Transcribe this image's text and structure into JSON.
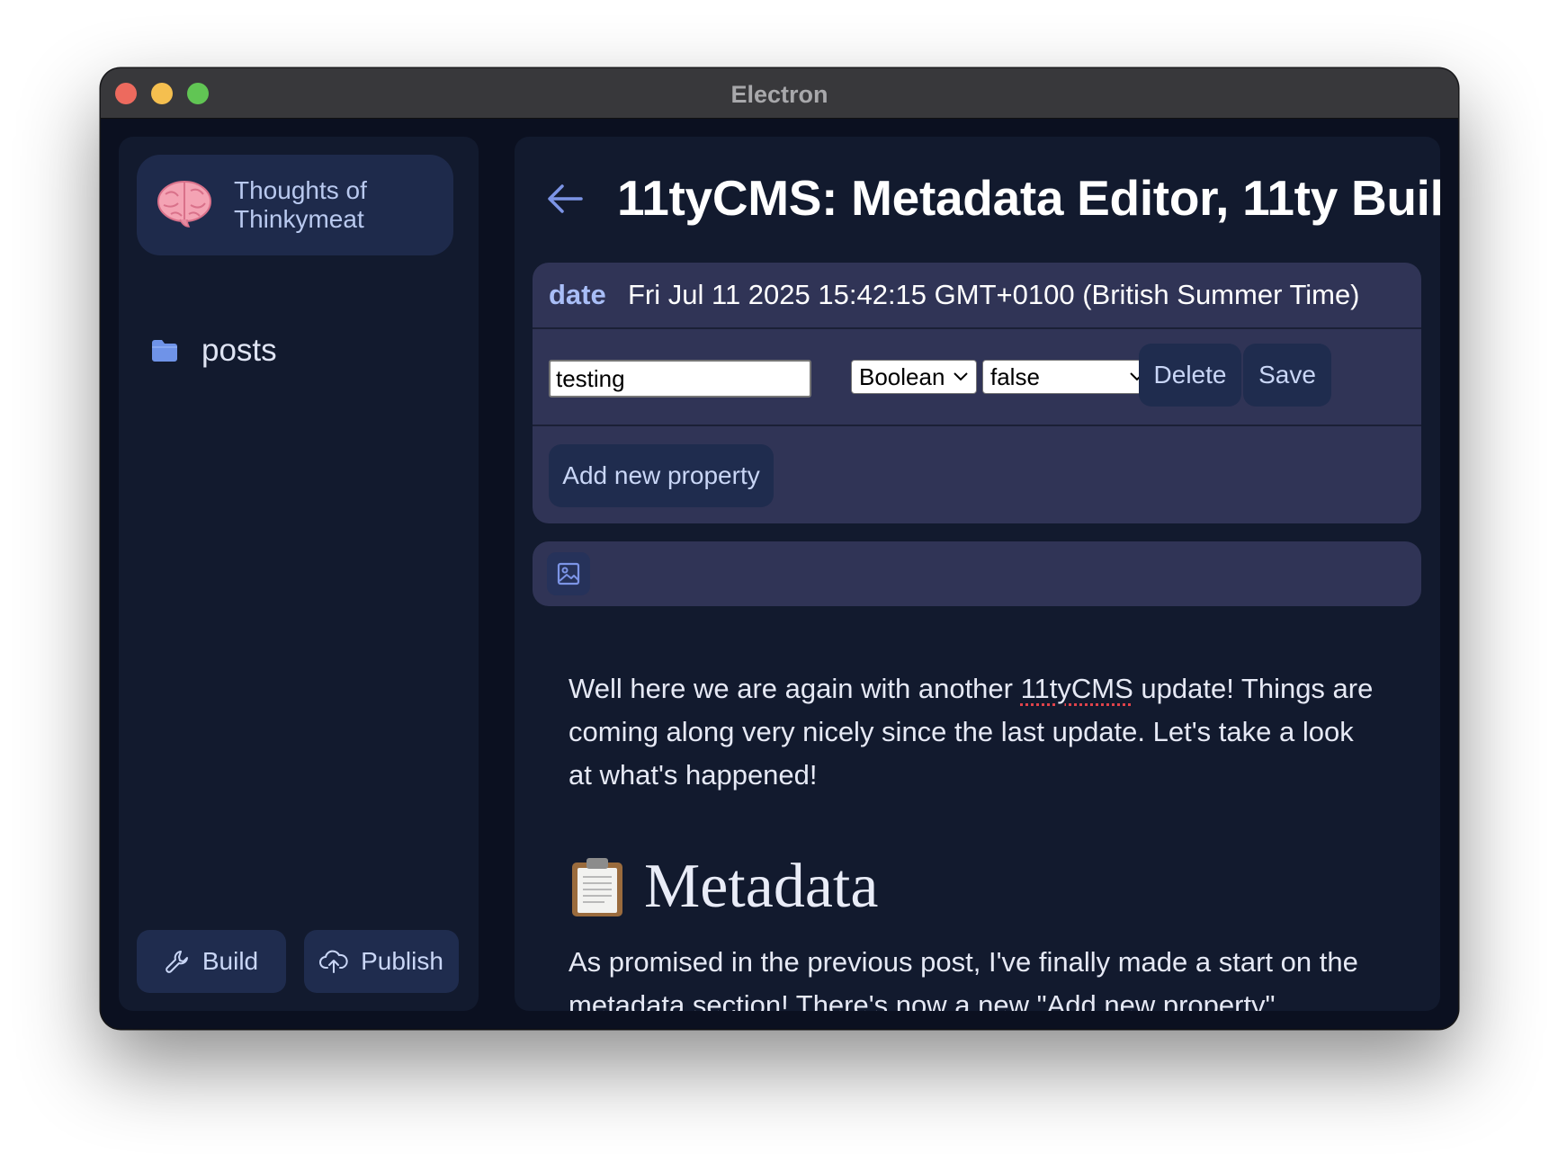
{
  "window": {
    "title": "Electron"
  },
  "sidebar": {
    "site_title": "Thoughts of Thinkymeat",
    "nav_items": [
      {
        "label": "posts"
      }
    ],
    "build_label": "Build",
    "publish_label": "Publish"
  },
  "main": {
    "page_title": "11tyCMS: Metadata Editor, 11ty Buil",
    "metadata": {
      "date_key": "date",
      "date_value": "Fri Jul 11 2025 15:42:15 GMT+0100 (British Summer Time)",
      "property_name_value": "testing",
      "type_select_value": "Boolean",
      "value_select_value": "false",
      "delete_label": "Delete",
      "save_label": "Save",
      "add_label": "Add new property"
    },
    "content": {
      "para1_before": "Well here we are again with another ",
      "para1_word": "11tyCMS",
      "para1_after": " update! Things are coming along very nicely since the last update. Let's take a look at what's happened!",
      "heading": "Metadata",
      "para2": "As promised in the previous post, I've finally made a start on the metadata section! There's now a new \"Add new property\""
    }
  },
  "colors": {
    "window_bg": "#0b1020",
    "panel_bg": "#121a2e",
    "card_bg": "#303456",
    "button_bg": "#1f2c4e",
    "accent": "#a9bef7"
  },
  "icons": [
    "brain-icon",
    "folder-icon",
    "wrench-icon",
    "cloud-upload-icon",
    "back-arrow-icon",
    "chevron-down-icon",
    "image-icon",
    "clipboard-icon"
  ]
}
